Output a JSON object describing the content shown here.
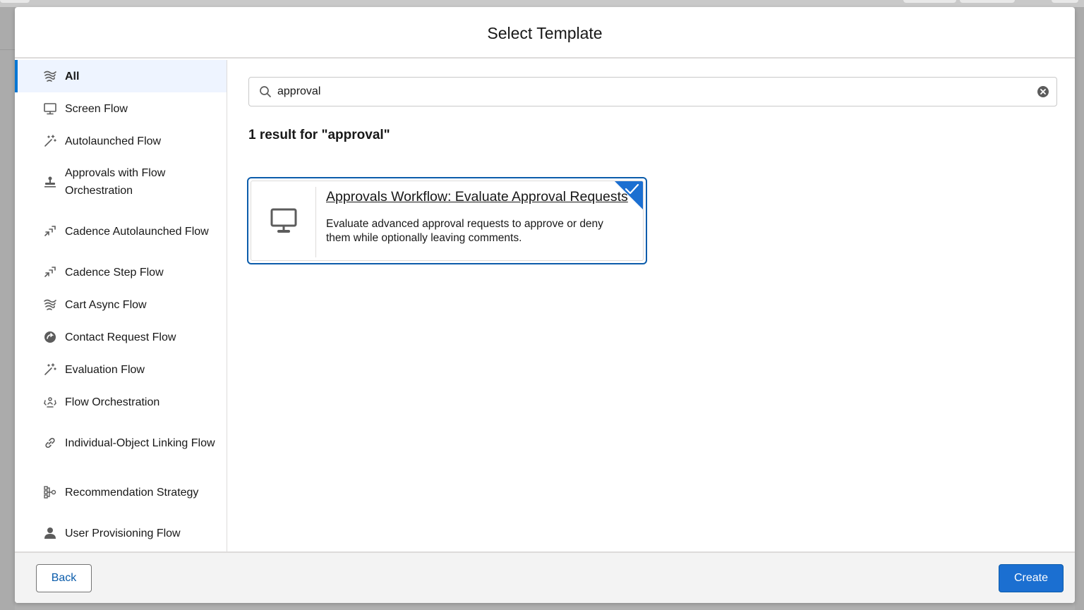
{
  "modal": {
    "title": "Select Template"
  },
  "sidebar": {
    "items": [
      {
        "label": "All",
        "icon": "waves-icon",
        "active": true,
        "lines": 1
      },
      {
        "label": "Screen Flow",
        "icon": "desktop-icon",
        "active": false,
        "lines": 1
      },
      {
        "label": "Autolaunched Flow",
        "icon": "magic-wand-icon",
        "active": false,
        "lines": 1
      },
      {
        "label": "Approvals with Flow Orchestration",
        "icon": "stamp-icon",
        "active": false,
        "lines": 2
      },
      {
        "label": "Cadence Autolaunched Flow",
        "icon": "cadence-icon",
        "active": false,
        "lines": 2
      },
      {
        "label": "Cadence Step Flow",
        "icon": "cadence-icon",
        "active": false,
        "lines": 1
      },
      {
        "label": "Cart Async Flow",
        "icon": "waves-icon",
        "active": false,
        "lines": 1
      },
      {
        "label": "Contact Request Flow",
        "icon": "contact-request-icon",
        "active": false,
        "lines": 1
      },
      {
        "label": "Evaluation Flow",
        "icon": "magic-wand-icon",
        "active": false,
        "lines": 1
      },
      {
        "label": "Flow Orchestration",
        "icon": "orchestration-icon",
        "active": false,
        "lines": 1
      },
      {
        "label": "Individual-Object Linking Flow",
        "icon": "link-icon",
        "active": false,
        "lines": 2
      },
      {
        "label": "Recommendation Strategy",
        "icon": "strategy-icon",
        "active": false,
        "lines": 2
      },
      {
        "label": "User Provisioning Flow",
        "icon": "user-icon",
        "active": false,
        "lines": 1
      }
    ]
  },
  "search": {
    "value": "approval",
    "placeholder": ""
  },
  "results": {
    "count_text": "1 result for \"approval\"",
    "cards": [
      {
        "title": "Approvals Workflow: Evaluate Approval Requests",
        "description": "Evaluate advanced approval requests to approve or deny them while optionally leaving comments.",
        "icon": "desktop-icon",
        "selected": true
      }
    ]
  },
  "footer": {
    "back_label": "Back",
    "create_label": "Create"
  },
  "colors": {
    "brand": "#0b5cab",
    "active_bg": "#eef4ff",
    "active_bar": "#0176d3",
    "create_button": "#1b6fd1",
    "icon_gray": "#5c5c5c"
  }
}
